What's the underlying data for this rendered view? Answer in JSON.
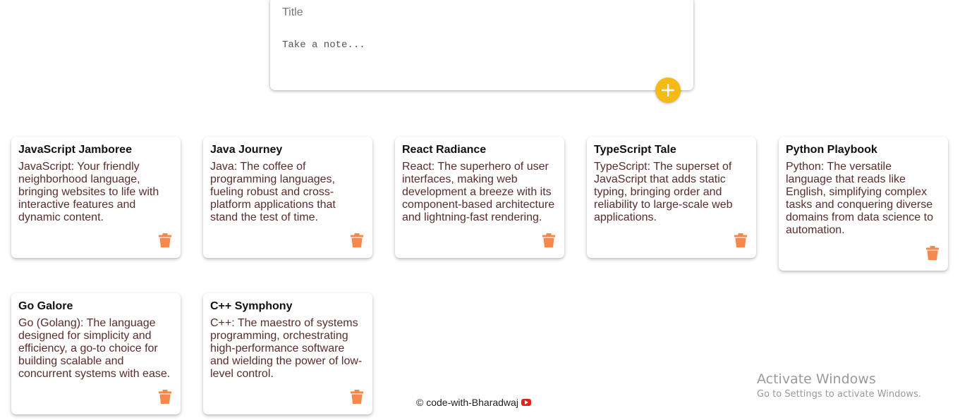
{
  "composer": {
    "title_placeholder": "Title",
    "content_placeholder": "Take a note..."
  },
  "notes": [
    {
      "title": "JavaScript Jamboree",
      "content": "JavaScript: Your friendly neighborhood language, bringing websites to life with interactive features and dynamic content."
    },
    {
      "title": "Java Journey",
      "content": "Java: The coffee of programming languages, fueling robust and cross-platform applications that stand the test of time."
    },
    {
      "title": "React Radiance",
      "content": "React: The superhero of user interfaces, making web development a breeze with its component-based architecture and lightning-fast rendering."
    },
    {
      "title": "TypeScript Tale",
      "content": "TypeScript: The superset of JavaScript that adds static typing, bringing order and reliability to large-scale web applications."
    },
    {
      "title": "Python Playbook",
      "content": "Python: The versatile language that reads like English, simplifying complex tasks and conquering diverse domains from data science to automation."
    },
    {
      "title": "Go Galore",
      "content": "Go (Golang): The language designed for simplicity and efficiency, a go-to choice for building scalable and concurrent systems with ease."
    },
    {
      "title": "C++ Symphony",
      "content": "C++: The maestro of systems programming, orchestrating high-performance software and wielding the power of low-level control."
    }
  ],
  "footer": {
    "text": "© code-with-Bharadwaj",
    "icon": "youtube-icon"
  },
  "watermark": {
    "title": "Activate Windows",
    "subtitle": "Go to Settings to activate Windows."
  },
  "colors": {
    "accent": "#f5ba13",
    "delete_icon": "#f5884a",
    "note_text": "#5a2d2d"
  }
}
